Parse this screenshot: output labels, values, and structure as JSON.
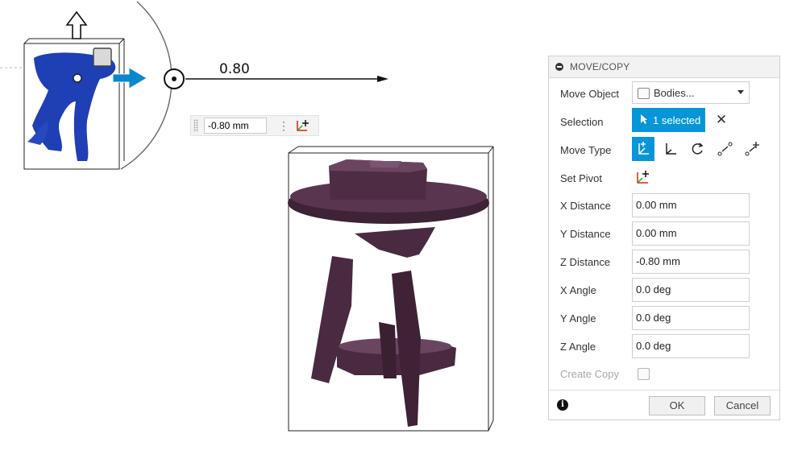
{
  "viewport": {
    "distance_label": "0.80",
    "inline_value": "-0.80 mm"
  },
  "panel": {
    "title": "MOVE/COPY",
    "rows": {
      "move_object": {
        "label": "Move Object",
        "value": "Bodies..."
      },
      "selection": {
        "label": "Selection",
        "value": "1 selected"
      },
      "move_type": {
        "label": "Move Type"
      },
      "set_pivot": {
        "label": "Set Pivot"
      },
      "x_distance": {
        "label": "X Distance",
        "value": "0.00 mm"
      },
      "y_distance": {
        "label": "Y Distance",
        "value": "0.00 mm"
      },
      "z_distance": {
        "label": "Z Distance",
        "value": "-0.80 mm"
      },
      "x_angle": {
        "label": "X Angle",
        "value": "0.0 deg"
      },
      "y_angle": {
        "label": "Y Angle",
        "value": "0.0 deg"
      },
      "z_angle": {
        "label": "Z Angle",
        "value": "0.0 deg"
      },
      "create_copy": {
        "label": "Create Copy",
        "checked": false
      }
    },
    "footer": {
      "ok_label": "OK",
      "cancel_label": "Cancel"
    }
  },
  "colors": {
    "accent": "#0696d7",
    "model_blue": "#1f3fb5",
    "model_purple": "#4a2a40"
  }
}
